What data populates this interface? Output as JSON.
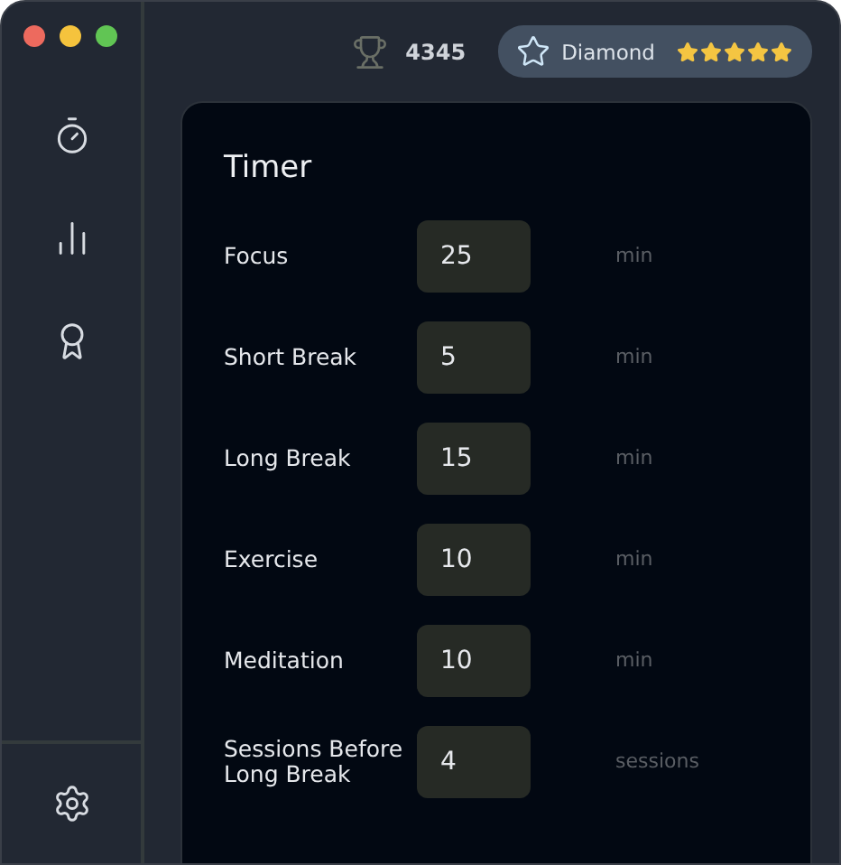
{
  "header": {
    "points": "4345",
    "rank": {
      "label": "Diamond",
      "stars": 5
    }
  },
  "sidebar": {
    "items": [
      {
        "kind": "timer",
        "selected": false
      },
      {
        "kind": "stats",
        "selected": false
      },
      {
        "kind": "award",
        "selected": false
      }
    ]
  },
  "panel": {
    "title": "Timer",
    "rows": [
      {
        "label": "Focus",
        "value": "25",
        "unit": "min"
      },
      {
        "label": "Short Break",
        "value": "5",
        "unit": "min"
      },
      {
        "label": "Long Break",
        "value": "15",
        "unit": "min"
      },
      {
        "label": "Exercise",
        "value": "10",
        "unit": "min"
      },
      {
        "label": "Meditation",
        "value": "10",
        "unit": "min"
      },
      {
        "label": "Sessions Before Long Break",
        "value": "4",
        "unit": "sessions"
      }
    ]
  }
}
